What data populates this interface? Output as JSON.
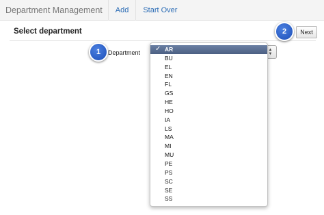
{
  "nav": {
    "brand": "Department Management",
    "links": [
      "Add",
      "Start Over"
    ]
  },
  "section": {
    "title": "Select department",
    "next_label": "Next"
  },
  "form": {
    "department_label": "Department",
    "selected": "AR",
    "options": [
      "AR",
      "BU",
      "EL",
      "EN",
      "FL",
      "GS",
      "HE",
      "HO",
      "IA",
      "LS",
      "MA",
      "MI",
      "MU",
      "PE",
      "PS",
      "SC",
      "SE",
      "SS"
    ]
  },
  "callouts": [
    "1",
    "2"
  ],
  "colors": {
    "link": "#2a6bb5",
    "selected_row": "#5a6e92",
    "badge": "#2a5fc9"
  }
}
